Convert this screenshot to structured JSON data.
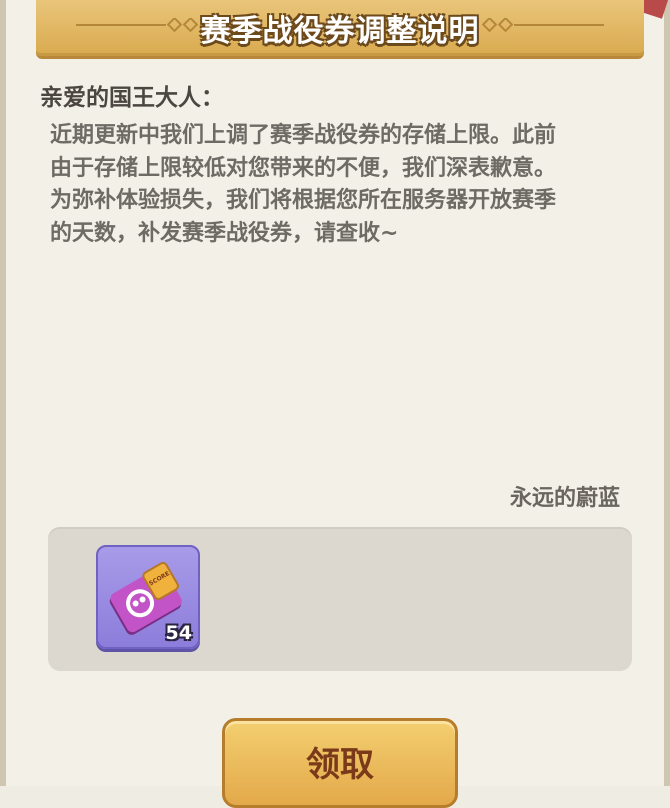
{
  "dialog": {
    "title": "赛季战役券调整说明",
    "greeting": "亲爱的国王大人：",
    "body_lines": [
      "近期更新中我们上调了赛季战役券的存储上限。此前",
      "由于存储上限较低对您带来的不便，我们深表歉意。",
      "为弥补体验损失，我们将根据您所在服务器开放赛季",
      "的天数，补发赛季战役券，请查收~"
    ],
    "signature": "永远的蔚蓝"
  },
  "reward": {
    "item_icon": "season-battle-ticket-icon",
    "count": "54",
    "ticket_text": "SCORE"
  },
  "claim_button": {
    "label": "领取"
  },
  "colors": {
    "banner": "#d9aa4f",
    "item_card": "#8c7ddb",
    "ticket": "#c254c8",
    "button": "#e3a94a"
  }
}
